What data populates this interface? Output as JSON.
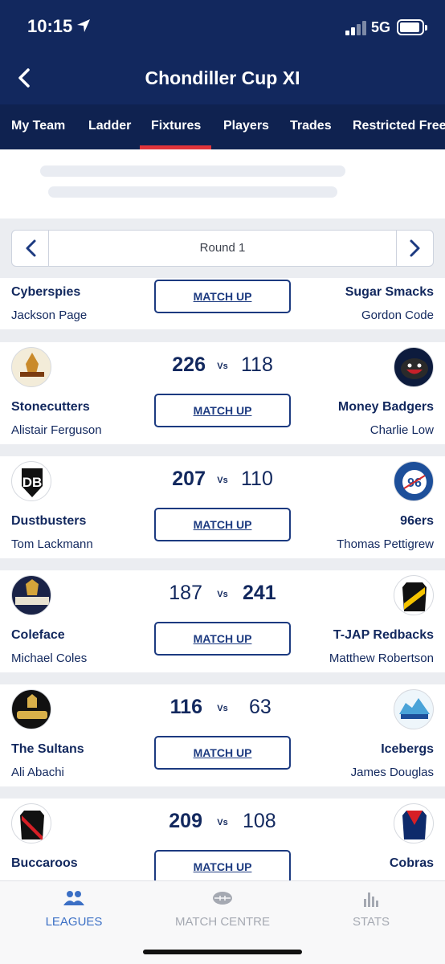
{
  "status": {
    "time": "10:15",
    "network": "5G"
  },
  "header": {
    "title": "Chondiller Cup XI"
  },
  "tabs": [
    {
      "label": "My Team"
    },
    {
      "label": "Ladder"
    },
    {
      "label": "Fixtures",
      "active": true
    },
    {
      "label": "Players"
    },
    {
      "label": "Trades"
    },
    {
      "label": "Restricted Free"
    }
  ],
  "round": {
    "label": "Round 1"
  },
  "matchup_label": "MATCH UP",
  "vs_label": "Vs",
  "partial_match": {
    "home": {
      "team": "Cyberspies",
      "coach": "Jackson Page"
    },
    "away": {
      "team": "Sugar Smacks",
      "coach": "Gordon Code"
    }
  },
  "matches": [
    {
      "home": {
        "team": "Stonecutters",
        "coach": "Alistair Ferguson",
        "logo": "stonecutters-logo",
        "score": "226"
      },
      "away": {
        "team": "Money Badgers",
        "coach": "Charlie Low",
        "logo": "money-badgers-logo",
        "score": "118"
      },
      "winner": "home"
    },
    {
      "home": {
        "team": "Dustbusters",
        "coach": "Tom Lackmann",
        "logo": "dustbusters-logo",
        "score": "207"
      },
      "away": {
        "team": "96ers",
        "coach": "Thomas Pettigrew",
        "logo": "96ers-logo",
        "score": "110"
      },
      "winner": "home"
    },
    {
      "home": {
        "team": "Coleface",
        "coach": "Michael Coles",
        "logo": "coleface-logo",
        "score": "187"
      },
      "away": {
        "team": "T-JAP Redbacks",
        "coach": "Matthew Robertson",
        "logo": "redbacks-guernsey-logo",
        "score": "241"
      },
      "winner": "away"
    },
    {
      "home": {
        "team": "The Sultans",
        "coach": "Ali Abachi",
        "logo": "sultans-logo",
        "score": "116"
      },
      "away": {
        "team": "Icebergs",
        "coach": "James Douglas",
        "logo": "icebergs-logo",
        "score": "63"
      },
      "winner": "home"
    },
    {
      "home": {
        "team": "Buccaroos",
        "coach": "",
        "logo": "buccaroos-guernsey-logo",
        "score": "209"
      },
      "away": {
        "team": "Cobras",
        "coach": "",
        "logo": "cobras-guernsey-logo",
        "score": "108"
      },
      "winner": "home"
    }
  ],
  "bottom_nav": [
    {
      "label": "LEAGUES",
      "icon": "users-icon",
      "active": true
    },
    {
      "label": "MATCH CENTRE",
      "icon": "football-icon"
    },
    {
      "label": "STATS",
      "icon": "bar-chart-icon"
    }
  ],
  "colors": {
    "header": "#12285e",
    "tabs": "#0f2250",
    "accent": "#e0343a",
    "active_nav": "#3b6fc5"
  }
}
